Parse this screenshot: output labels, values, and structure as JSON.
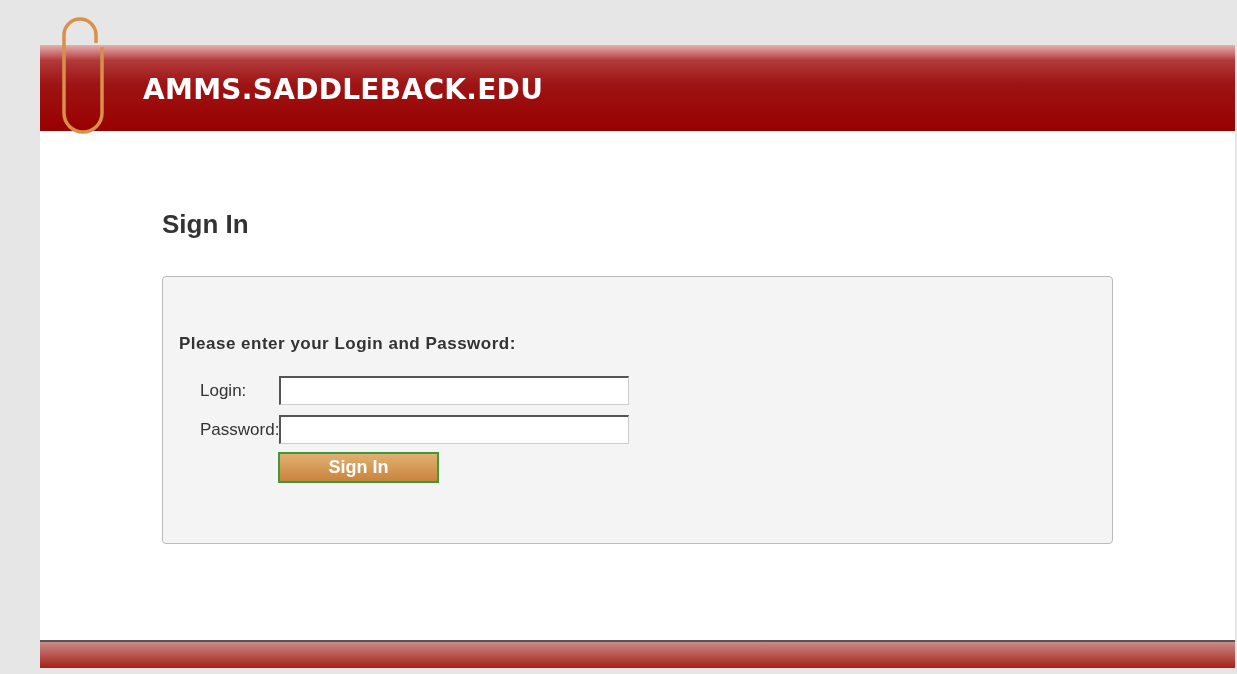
{
  "header": {
    "title": "AMMS.SADDLEBACK.EDU"
  },
  "page_title": "Sign In",
  "form": {
    "instruction": "Please enter your Login and Password:",
    "fields": [
      {
        "label": "Login:"
      },
      {
        "label": "Password:"
      }
    ],
    "button": "Sign In"
  }
}
